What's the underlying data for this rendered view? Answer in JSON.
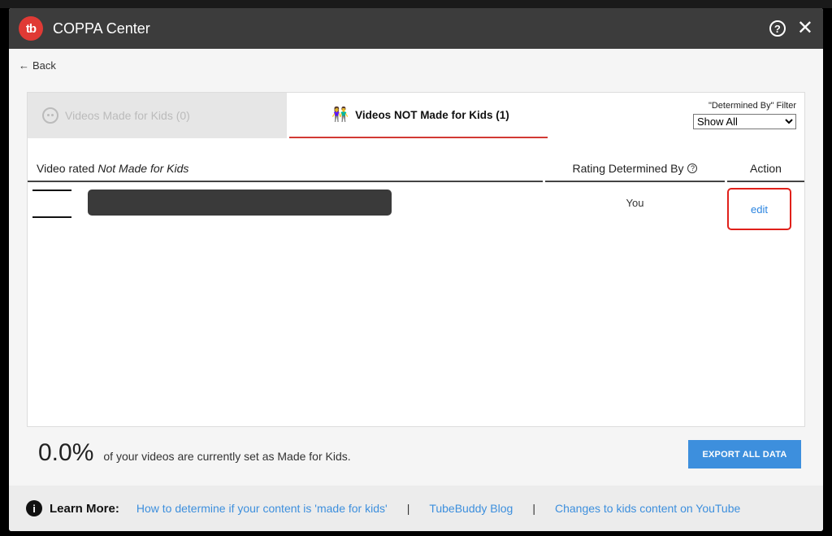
{
  "window": {
    "title": "COPPA Center",
    "logo_text": "tb"
  },
  "nav": {
    "back_label": "Back"
  },
  "tabs": [
    {
      "label": "Videos Made for Kids (0)"
    },
    {
      "label": "Videos NOT Made for Kids (1)"
    }
  ],
  "filter": {
    "label": "\"Determined By\" Filter",
    "selected": "Show All"
  },
  "table": {
    "headers": {
      "video_prefix": "Video rated ",
      "video_emph": "Not Made for Kids",
      "rating": "Rating Determined By",
      "action": "Action"
    },
    "rows": [
      {
        "determined_by": "You",
        "action": "edit"
      }
    ]
  },
  "stats": {
    "percent": "0.0%",
    "text": "of your videos are currently set as Made for Kids."
  },
  "export_label": "EXPORT ALL DATA",
  "footer": {
    "learn_more": "Learn More:",
    "links": [
      "How to determine if your content is 'made for kids'",
      "TubeBuddy Blog",
      "Changes to kids content on YouTube"
    ]
  }
}
